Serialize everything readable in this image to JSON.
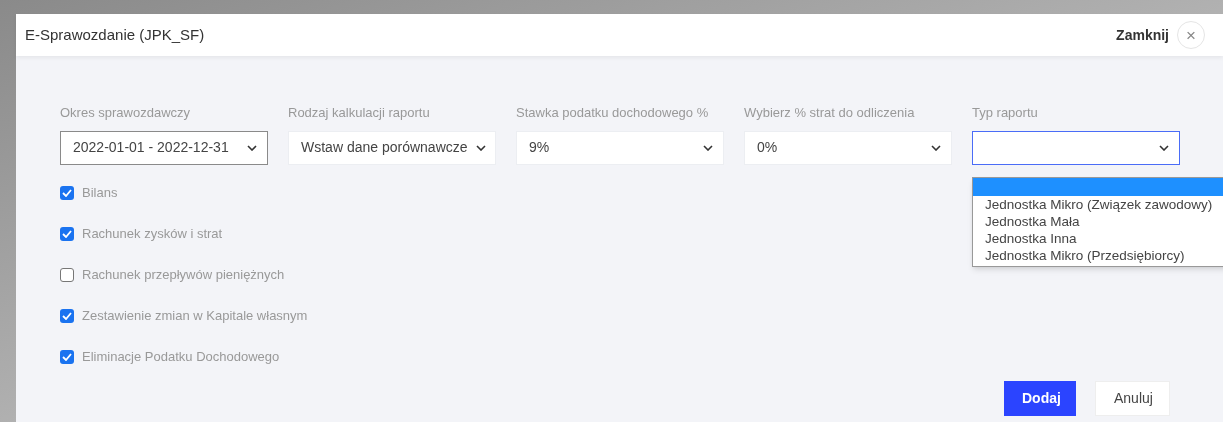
{
  "dialog": {
    "title": "E-Sprawozdanie (JPK_SF)",
    "close_label": "Zamknij",
    "close_icon": "×"
  },
  "fields": [
    {
      "label": "Okres sprawozdawczy",
      "value": "2022-01-01 - 2022-12-31",
      "bordered": true
    },
    {
      "label": "Rodzaj kalkulacji raportu",
      "value": "Wstaw dane porównawcze",
      "bordered": false
    },
    {
      "label": "Stawka podatku dochodowego %",
      "value": "9%",
      "bordered": false
    },
    {
      "label": "Wybierz % strat do odliczenia",
      "value": "0%",
      "bordered": false
    },
    {
      "label": "Typ raportu",
      "expanded": true,
      "blank_option_highlighted": true,
      "options": [
        {
          "label": "Jednostka Mikro (Związek zawodowy)",
          "selected": false
        },
        {
          "label": "Jednostka Mała",
          "selected": false
        },
        {
          "label": "Jednostka Inna",
          "selected": false
        },
        {
          "label": "Jednostka Mikro (Przedsiębiorcy)",
          "selected": false
        }
      ]
    }
  ],
  "checkboxes": [
    {
      "label": "Bilans",
      "checked": true
    },
    {
      "label": "Rachunek zysków i strat",
      "checked": true
    },
    {
      "label": "Rachunek przepływów pieniężnych",
      "checked": false
    },
    {
      "label": "Zestawienie zmian w Kapitale własnym",
      "checked": true
    },
    {
      "label": "Eliminacje Podatku Dochodowego",
      "checked": true
    }
  ],
  "buttons": [
    {
      "label": "Dodaj",
      "kind": "primary"
    },
    {
      "label": "Anuluj",
      "kind": "secondary"
    }
  ]
}
